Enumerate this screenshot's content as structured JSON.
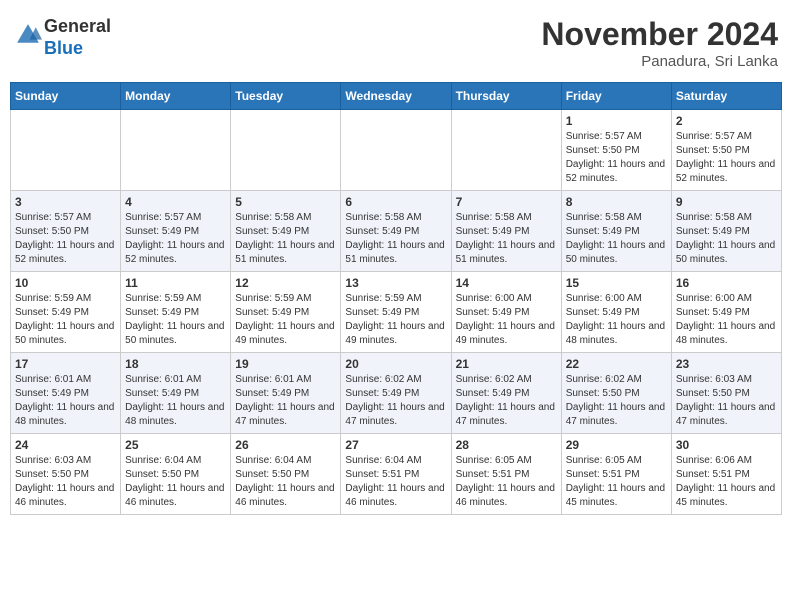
{
  "header": {
    "logo_general": "General",
    "logo_blue": "Blue",
    "month_title": "November 2024",
    "location": "Panadura, Sri Lanka"
  },
  "calendar": {
    "days_of_week": [
      "Sunday",
      "Monday",
      "Tuesday",
      "Wednesday",
      "Thursday",
      "Friday",
      "Saturday"
    ],
    "weeks": [
      [
        {
          "day": "",
          "info": ""
        },
        {
          "day": "",
          "info": ""
        },
        {
          "day": "",
          "info": ""
        },
        {
          "day": "",
          "info": ""
        },
        {
          "day": "",
          "info": ""
        },
        {
          "day": "1",
          "info": "Sunrise: 5:57 AM\nSunset: 5:50 PM\nDaylight: 11 hours\nand 52 minutes."
        },
        {
          "day": "2",
          "info": "Sunrise: 5:57 AM\nSunset: 5:50 PM\nDaylight: 11 hours\nand 52 minutes."
        }
      ],
      [
        {
          "day": "3",
          "info": "Sunrise: 5:57 AM\nSunset: 5:50 PM\nDaylight: 11 hours\nand 52 minutes."
        },
        {
          "day": "4",
          "info": "Sunrise: 5:57 AM\nSunset: 5:49 PM\nDaylight: 11 hours\nand 52 minutes."
        },
        {
          "day": "5",
          "info": "Sunrise: 5:58 AM\nSunset: 5:49 PM\nDaylight: 11 hours\nand 51 minutes."
        },
        {
          "day": "6",
          "info": "Sunrise: 5:58 AM\nSunset: 5:49 PM\nDaylight: 11 hours\nand 51 minutes."
        },
        {
          "day": "7",
          "info": "Sunrise: 5:58 AM\nSunset: 5:49 PM\nDaylight: 11 hours\nand 51 minutes."
        },
        {
          "day": "8",
          "info": "Sunrise: 5:58 AM\nSunset: 5:49 PM\nDaylight: 11 hours\nand 50 minutes."
        },
        {
          "day": "9",
          "info": "Sunrise: 5:58 AM\nSunset: 5:49 PM\nDaylight: 11 hours\nand 50 minutes."
        }
      ],
      [
        {
          "day": "10",
          "info": "Sunrise: 5:59 AM\nSunset: 5:49 PM\nDaylight: 11 hours\nand 50 minutes."
        },
        {
          "day": "11",
          "info": "Sunrise: 5:59 AM\nSunset: 5:49 PM\nDaylight: 11 hours\nand 50 minutes."
        },
        {
          "day": "12",
          "info": "Sunrise: 5:59 AM\nSunset: 5:49 PM\nDaylight: 11 hours\nand 49 minutes."
        },
        {
          "day": "13",
          "info": "Sunrise: 5:59 AM\nSunset: 5:49 PM\nDaylight: 11 hours\nand 49 minutes."
        },
        {
          "day": "14",
          "info": "Sunrise: 6:00 AM\nSunset: 5:49 PM\nDaylight: 11 hours\nand 49 minutes."
        },
        {
          "day": "15",
          "info": "Sunrise: 6:00 AM\nSunset: 5:49 PM\nDaylight: 11 hours\nand 48 minutes."
        },
        {
          "day": "16",
          "info": "Sunrise: 6:00 AM\nSunset: 5:49 PM\nDaylight: 11 hours\nand 48 minutes."
        }
      ],
      [
        {
          "day": "17",
          "info": "Sunrise: 6:01 AM\nSunset: 5:49 PM\nDaylight: 11 hours\nand 48 minutes."
        },
        {
          "day": "18",
          "info": "Sunrise: 6:01 AM\nSunset: 5:49 PM\nDaylight: 11 hours\nand 48 minutes."
        },
        {
          "day": "19",
          "info": "Sunrise: 6:01 AM\nSunset: 5:49 PM\nDaylight: 11 hours\nand 47 minutes."
        },
        {
          "day": "20",
          "info": "Sunrise: 6:02 AM\nSunset: 5:49 PM\nDaylight: 11 hours\nand 47 minutes."
        },
        {
          "day": "21",
          "info": "Sunrise: 6:02 AM\nSunset: 5:49 PM\nDaylight: 11 hours\nand 47 minutes."
        },
        {
          "day": "22",
          "info": "Sunrise: 6:02 AM\nSunset: 5:50 PM\nDaylight: 11 hours\nand 47 minutes."
        },
        {
          "day": "23",
          "info": "Sunrise: 6:03 AM\nSunset: 5:50 PM\nDaylight: 11 hours\nand 47 minutes."
        }
      ],
      [
        {
          "day": "24",
          "info": "Sunrise: 6:03 AM\nSunset: 5:50 PM\nDaylight: 11 hours\nand 46 minutes."
        },
        {
          "day": "25",
          "info": "Sunrise: 6:04 AM\nSunset: 5:50 PM\nDaylight: 11 hours\nand 46 minutes."
        },
        {
          "day": "26",
          "info": "Sunrise: 6:04 AM\nSunset: 5:50 PM\nDaylight: 11 hours\nand 46 minutes."
        },
        {
          "day": "27",
          "info": "Sunrise: 6:04 AM\nSunset: 5:51 PM\nDaylight: 11 hours\nand 46 minutes."
        },
        {
          "day": "28",
          "info": "Sunrise: 6:05 AM\nSunset: 5:51 PM\nDaylight: 11 hours\nand 46 minutes."
        },
        {
          "day": "29",
          "info": "Sunrise: 6:05 AM\nSunset: 5:51 PM\nDaylight: 11 hours\nand 45 minutes."
        },
        {
          "day": "30",
          "info": "Sunrise: 6:06 AM\nSunset: 5:51 PM\nDaylight: 11 hours\nand 45 minutes."
        }
      ]
    ]
  }
}
